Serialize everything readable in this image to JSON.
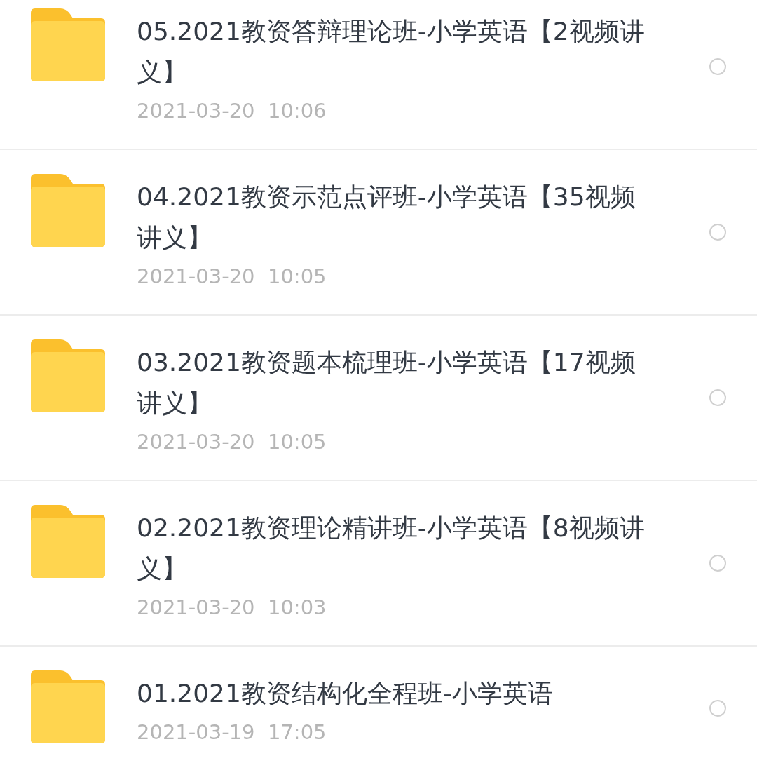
{
  "files": [
    {
      "title": "05.2021教资答辩理论班-小学英语【2视频讲义】",
      "date": "2021-03-20  10:06",
      "selected": false
    },
    {
      "title": "04.2021教资示范点评班-小学英语【35视频讲义】",
      "date": "2021-03-20  10:05",
      "selected": false
    },
    {
      "title": "03.2021教资题本梳理班-小学英语【17视频讲义】",
      "date": "2021-03-20  10:05",
      "selected": false
    },
    {
      "title": "02.2021教资理论精讲班-小学英语【8视频讲义】",
      "date": "2021-03-20  10:03",
      "selected": false
    },
    {
      "title": "01.2021教资结构化全程班-小学英语",
      "date": "2021-03-19  17:05",
      "selected": false
    }
  ]
}
